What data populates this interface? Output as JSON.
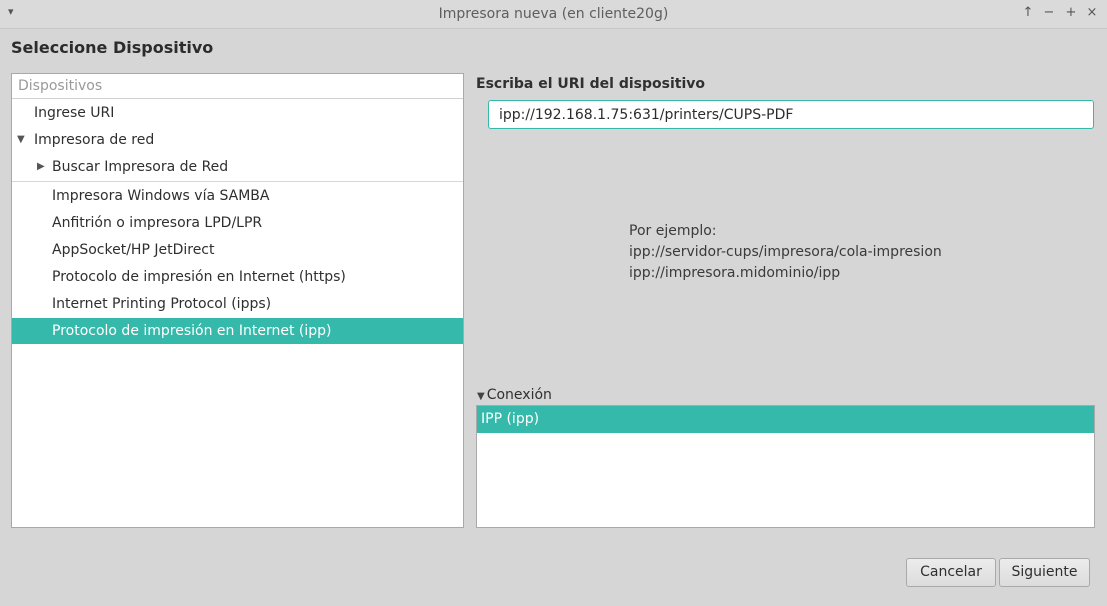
{
  "window": {
    "title": "Impresora nueva (en cliente20g)"
  },
  "page": {
    "heading": "Seleccione Dispositivo"
  },
  "devices": {
    "header": "Dispositivos",
    "items": [
      {
        "label": "Ingrese URI"
      },
      {
        "label": "Impresora de red"
      },
      {
        "label": "Buscar Impresora de Red"
      },
      {
        "label": "Impresora Windows vía SAMBA"
      },
      {
        "label": "Anfitrión o impresora LPD/LPR"
      },
      {
        "label": "AppSocket/HP JetDirect"
      },
      {
        "label": "Protocolo de impresión en Internet (https)"
      },
      {
        "label": "Internet Printing Protocol (ipps)"
      },
      {
        "label": "Protocolo de impresión en Internet (ipp)"
      }
    ],
    "selected": "Protocolo de impresión en Internet (ipp)"
  },
  "uri": {
    "label": "Escriba el URI del dispositivo",
    "value": "ipp://192.168.1.75:631/printers/CUPS-PDF"
  },
  "example": {
    "line1": "Por ejemplo:",
    "line2": "ipp://servidor-cups/impresora/cola-impresion",
    "line3": "ipp://impresora.midominio/ipp"
  },
  "connection": {
    "label": "Conexión",
    "items": [
      {
        "label": "IPP (ipp)"
      }
    ]
  },
  "buttons": {
    "cancel": "Cancelar",
    "next": "Siguiente"
  },
  "colors": {
    "accent": "#35b9ab"
  }
}
